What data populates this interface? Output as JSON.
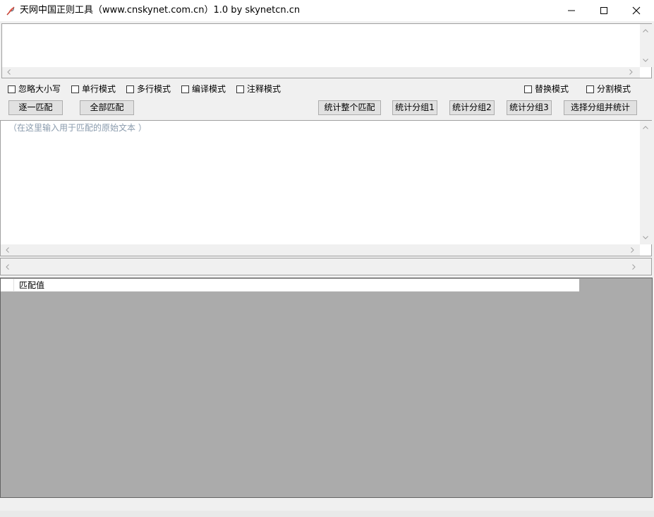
{
  "window": {
    "title": "天网中国正则工具（www.cnskynet.com.cn）1.0 by skynetcn.cn",
    "icon": "feather-app-icon",
    "controls": [
      "minimize-icon",
      "maximize-icon",
      "close-icon"
    ]
  },
  "regex_input": {
    "value": ""
  },
  "options": {
    "ignore_case": {
      "label": "忽略大小写",
      "checked": false
    },
    "single_line": {
      "label": "单行模式",
      "checked": false
    },
    "multi_line": {
      "label": "多行模式",
      "checked": false
    },
    "compiled": {
      "label": "编译模式",
      "checked": false
    },
    "comment": {
      "label": "注释模式",
      "checked": false
    },
    "replace": {
      "label": "替换模式",
      "checked": false
    },
    "split": {
      "label": "分割模式",
      "checked": false
    }
  },
  "buttons": {
    "match_next": "逐一匹配",
    "match_all": "全部匹配",
    "count_whole": "统计整个匹配",
    "count_group1": "统计分组1",
    "count_group2": "统计分组2",
    "count_group3": "统计分组3",
    "select_group_count": "选择分组并统计"
  },
  "source_text": {
    "placeholder": "（在这里输入用于匹配的原始文本 ）",
    "value": ""
  },
  "replace_text": {
    "value": ""
  },
  "results": {
    "columns": [
      "",
      "匹配值"
    ],
    "rows": []
  },
  "colors": {
    "placeholder": "#8a9bad",
    "results_background": "#ababab",
    "button_face": "#e1e1e1"
  }
}
